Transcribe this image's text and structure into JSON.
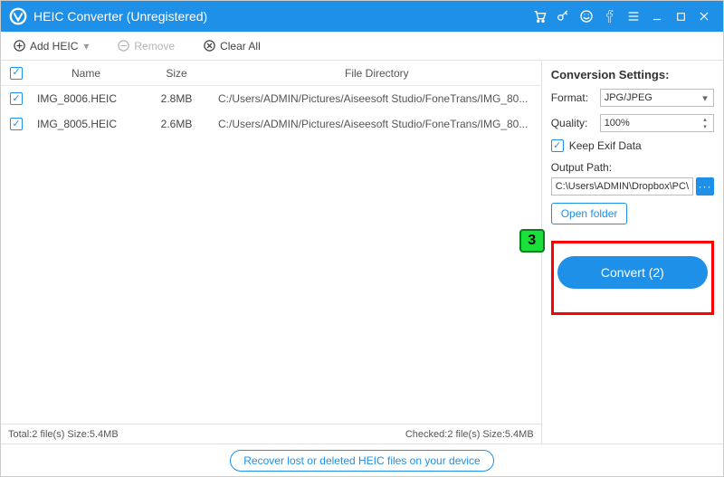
{
  "title": "HEIC Converter (Unregistered)",
  "toolbar": {
    "add_label": "Add HEIC",
    "remove_label": "Remove",
    "clear_label": "Clear All"
  },
  "columns": {
    "name": "Name",
    "size": "Size",
    "dir": "File Directory"
  },
  "files": [
    {
      "name": "IMG_8006.HEIC",
      "size": "2.8MB",
      "dir": "C:/Users/ADMIN/Pictures/Aiseesoft Studio/FoneTrans/IMG_80..."
    },
    {
      "name": "IMG_8005.HEIC",
      "size": "2.6MB",
      "dir": "C:/Users/ADMIN/Pictures/Aiseesoft Studio/FoneTrans/IMG_80..."
    }
  ],
  "status": {
    "total": "Total:2 file(s) Size:5.4MB",
    "checked": "Checked:2 file(s) Size:5.4MB"
  },
  "settings": {
    "heading": "Conversion Settings:",
    "format_label": "Format:",
    "format_value": "JPG/JPEG",
    "quality_label": "Quality:",
    "quality_value": "100%",
    "keep_exif_label": "Keep Exif Data",
    "output_path_label": "Output Path:",
    "output_path_value": "C:\\Users\\ADMIN\\Dropbox\\PC\\",
    "open_folder_label": "Open folder",
    "convert_label": "Convert (2)"
  },
  "annotation_badge": "3",
  "recover_link": "Recover lost or deleted HEIC files on your device"
}
